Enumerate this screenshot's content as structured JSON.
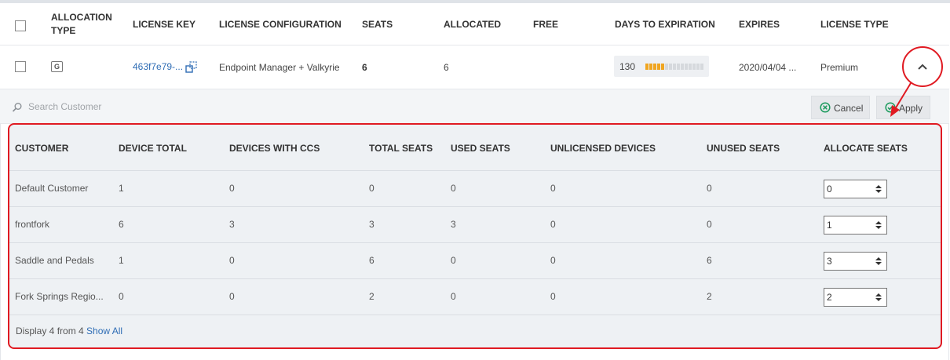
{
  "license_table": {
    "headers": {
      "allocation_type_line1": "ALLOCATION",
      "allocation_type_line2": "TYPE",
      "license_key": "LICENSE KEY",
      "license_configuration": "LICENSE CONFIGURATION",
      "seats": "SEATS",
      "allocated": "ALLOCATED",
      "free": "FREE",
      "days_to_expiration": "DAYS TO EXPIRATION",
      "expires": "EXPIRES",
      "license_type": "LICENSE TYPE"
    },
    "row": {
      "allocation_badge": "G",
      "license_key": "463f7e79-...",
      "license_configuration": "Endpoint Manager + Valkyrie",
      "seats": "6",
      "allocated": "6",
      "free": "",
      "days_to_expiration": "130",
      "days_bar_fraction": 0.3,
      "expires": "2020/04/04 ...",
      "license_type": "Premium"
    }
  },
  "search": {
    "placeholder": "Search Customer",
    "value": ""
  },
  "actions": {
    "cancel_label": "Cancel",
    "apply_label": "Apply"
  },
  "allocation_panel": {
    "headers": {
      "customer": "CUSTOMER",
      "device_total": "DEVICE TOTAL",
      "devices_with_ccs": "DEVICES WITH CCS",
      "total_seats": "TOTAL SEATS",
      "used_seats": "USED SEATS",
      "unlicensed_devices": "UNLICENSED DEVICES",
      "unused_seats": "UNUSED SEATS",
      "allocate_seats": "ALLOCATE SEATS"
    },
    "rows": [
      {
        "customer": "Default Customer",
        "device_total": "1",
        "devices_with_ccs": "0",
        "total_seats": "0",
        "used_seats": "0",
        "unlicensed_devices": "0",
        "unused_seats": "0",
        "allocate_seats": "0"
      },
      {
        "customer": "frontfork",
        "device_total": "6",
        "devices_with_ccs": "3",
        "total_seats": "3",
        "used_seats": "3",
        "unlicensed_devices": "0",
        "unused_seats": "0",
        "allocate_seats": "1"
      },
      {
        "customer": "Saddle and Pedals",
        "device_total": "1",
        "devices_with_ccs": "0",
        "total_seats": "6",
        "used_seats": "0",
        "unlicensed_devices": "0",
        "unused_seats": "6",
        "allocate_seats": "3"
      },
      {
        "customer": "Fork Springs Regio...",
        "device_total": "0",
        "devices_with_ccs": "0",
        "total_seats": "2",
        "used_seats": "0",
        "unlicensed_devices": "0",
        "unused_seats": "2",
        "allocate_seats": "2"
      }
    ],
    "footer": {
      "display_text": "Display 4 from 4",
      "show_all_label": "Show All"
    }
  },
  "colors": {
    "accent_link": "#2f6db5",
    "callout_red": "#e01a22",
    "bar_on": "#f0a520",
    "ok_green": "#1a9a5c"
  },
  "icons": {
    "search": "search-icon",
    "copy": "copy-icon",
    "collapse": "chevron-up-icon",
    "cancel": "x-circle-icon",
    "apply": "check-circle-icon",
    "spin": "spinner-arrows-icon"
  }
}
